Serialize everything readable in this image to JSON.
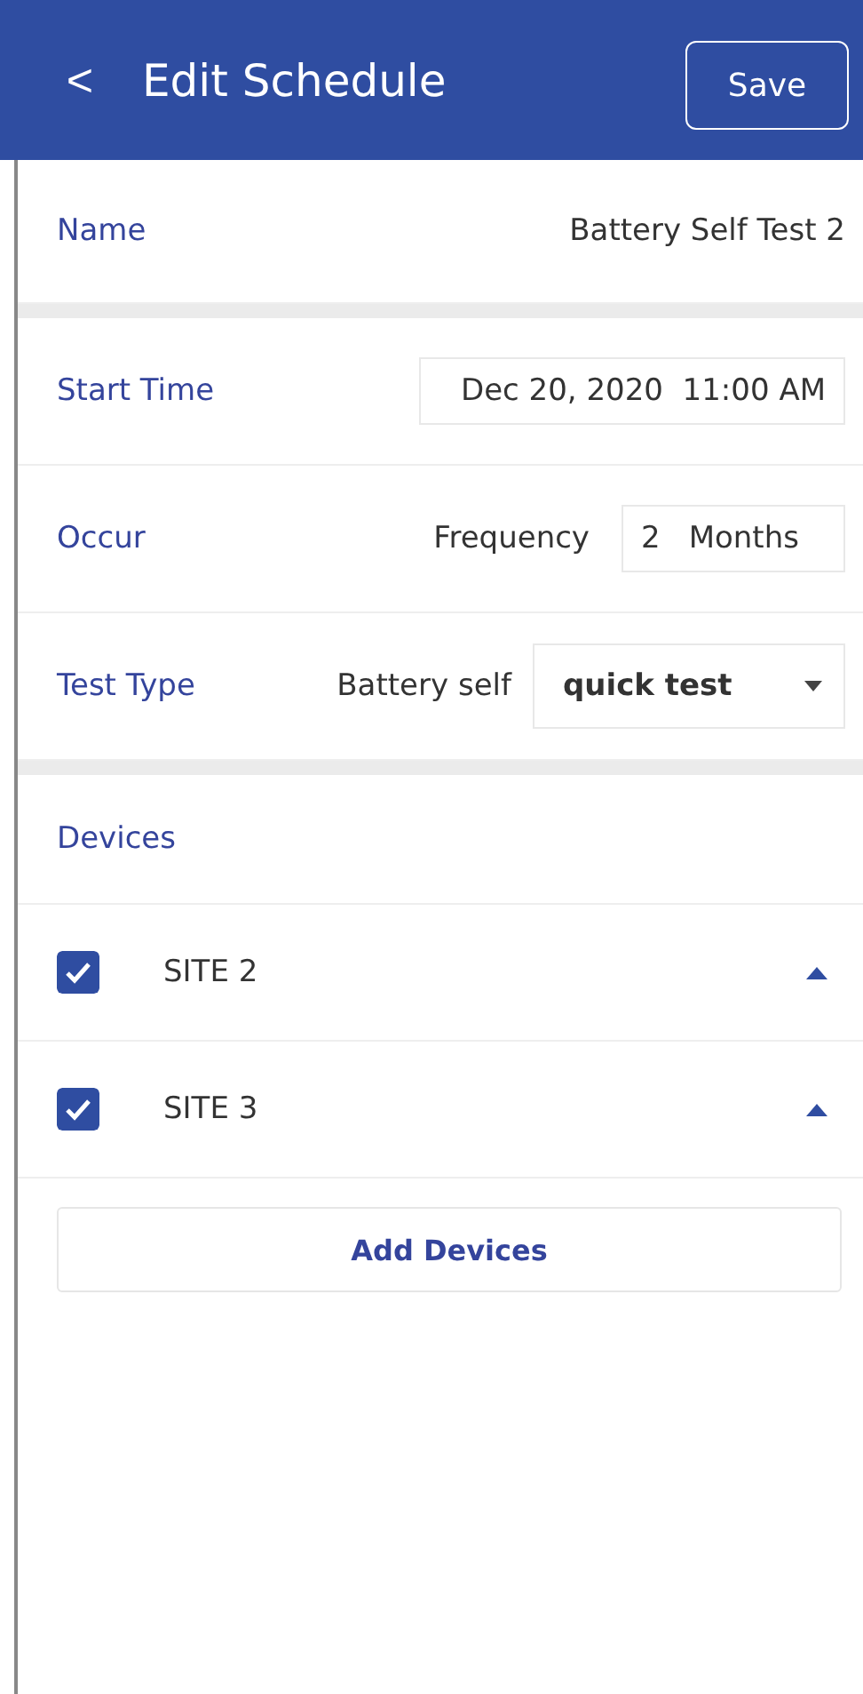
{
  "header": {
    "back": "<",
    "title": "Edit Schedule",
    "save": "Save"
  },
  "name": {
    "label": "Name",
    "value": "Battery Self Test 2"
  },
  "start_time": {
    "label": "Start Time",
    "value": "Dec 20, 2020  11:00 AM"
  },
  "occur": {
    "label": "Occur",
    "frequency_label": "Frequency",
    "count": "2",
    "unit": "Months"
  },
  "test_type": {
    "label": "Test Type",
    "prefix": "Battery self",
    "value": "quick test"
  },
  "devices": {
    "label": "Devices",
    "items": [
      {
        "name": "SITE 2",
        "checked": true,
        "expanded": true
      },
      {
        "name": "SITE 3",
        "checked": true,
        "expanded": true
      }
    ],
    "add_button": "Add Devices"
  }
}
